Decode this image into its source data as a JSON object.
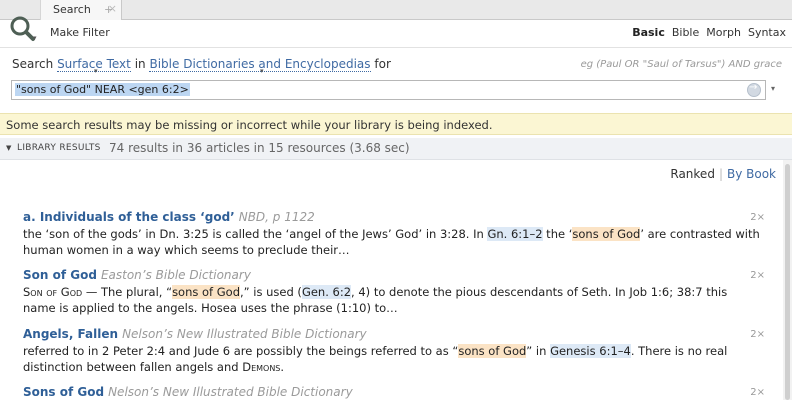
{
  "tab": {
    "label": "Search",
    "close": "×",
    "add": "+"
  },
  "toolbar": {
    "panel_menu": "▾",
    "make_filter": "Make Filter",
    "modes": [
      "Basic",
      "Bible",
      "Morph",
      "Syntax"
    ],
    "active_mode": "Basic"
  },
  "searchline": {
    "prefix": "Search",
    "field": "Surface Text",
    "in": "in",
    "collection": "Bible Dictionaries and Encyclopedias",
    "for": "for"
  },
  "example": "eg (Paul OR \"Saul of Tarsus\") AND grace",
  "query": {
    "value": "\"sons of God\" NEAR <gen 6:2>",
    "menu": "▾"
  },
  "warning": "Some search results may be missing or incorrect while your library is being indexed.",
  "results_header": {
    "chevron": "▼",
    "title": "LIBRARY RESULTS",
    "summary": "74 results in 36 articles in 15 resources (3.68 sec)"
  },
  "sort": {
    "ranked": "Ranked",
    "sep": "|",
    "by_book": "By Book"
  },
  "results": [
    {
      "title": "a. Individuals of the class ‘god’",
      "source": "NBD, p 1122",
      "count": "2×",
      "text": {
        "a": "the ‘son of the gods’ in Dn. 3:25 is called the ‘angel of the Jews’ God’ in 3:28. In ",
        "ref1": "Gn. 6:1–2",
        "b": " the ‘",
        "hl1": "sons of God",
        "c": "’ are contrasted with human women in a way which seems to preclude their…"
      }
    },
    {
      "title": "Son of God",
      "source": "Easton’s Bible Dictionary",
      "count": "2×",
      "text": {
        "a1": "Son of God",
        "a2": " — The plural, “",
        "hl1": "sons of God",
        "b": ",” is used (",
        "ref1": "Gen. 6:2",
        "c": ", 4) to denote the pious descendants of Seth. In Job 1:6; 38:7 this name is applied to the angels. Hosea uses the phrase (1:10) to…"
      }
    },
    {
      "title": "Angels, Fallen",
      "source": "Nelson’s New Illustrated Bible Dictionary",
      "count": "2×",
      "text": {
        "a": "referred to in 2 Peter 2:4 and Jude 6 are possibly the beings referred to as “",
        "hl1": "sons of God",
        "b": "” in ",
        "ref1": "Genesis 6:1–4",
        "c": ". There is no real distinction between fallen angels and ",
        "sc1": "Demons",
        "d": "."
      }
    },
    {
      "title": "Sons of God",
      "source": "Nelson’s New Illustrated Bible Dictionary",
      "count": "2×"
    }
  ]
}
